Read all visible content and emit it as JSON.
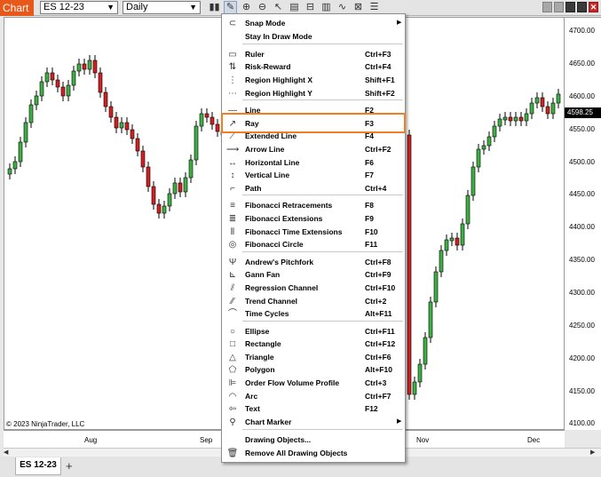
{
  "toolbar": {
    "chart_tab": "Chart",
    "instrument": "ES 12-23",
    "interval": "Daily",
    "icons": [
      "bars-icon",
      "draw-tool-icon",
      "zoom-in-icon",
      "zoom-out-icon",
      "pointer-icon",
      "data-box-icon",
      "properties-icon",
      "instrument-icon",
      "indicator-icon",
      "strategy-icon",
      "list-icon"
    ]
  },
  "chart": {
    "copyright": "© 2023 NinjaTrader, LLC",
    "current_price": "4598.25",
    "y_ticks": [
      "4700.00",
      "4650.00",
      "4600.00",
      "4550.00",
      "4500.00",
      "4450.00",
      "4400.00",
      "4350.00",
      "4300.00",
      "4250.00",
      "4200.00",
      "4150.00",
      "4100.00"
    ],
    "x_ticks": [
      "Aug",
      "Sep",
      "Nov",
      "Dec"
    ],
    "colors": {
      "up": "#3cb043",
      "down": "#d42020",
      "wick": "#000000"
    }
  },
  "bottom": {
    "instrument_tab": "ES 12-23",
    "add_tab": "+"
  },
  "menu": {
    "items": [
      {
        "label": "Snap Mode",
        "shortcut": "",
        "icon": "magnet-icon",
        "submenu": true
      },
      {
        "label": "Stay In Draw Mode",
        "shortcut": "",
        "icon": "",
        "submenu": false
      },
      {
        "label": "Ruler",
        "shortcut": "Ctrl+F3",
        "icon": "ruler-icon",
        "submenu": false
      },
      {
        "label": "Risk-Reward",
        "shortcut": "Ctrl+F4",
        "icon": "risk-reward-icon",
        "submenu": false
      },
      {
        "label": "Region Highlight X",
        "shortcut": "Shift+F1",
        "icon": "region-x-icon",
        "submenu": false
      },
      {
        "label": "Region Highlight Y",
        "shortcut": "Shift+F2",
        "icon": "region-y-icon",
        "submenu": false
      },
      {
        "label": "Line",
        "shortcut": "F2",
        "icon": "line-icon",
        "submenu": false
      },
      {
        "label": "Ray",
        "shortcut": "F3",
        "icon": "ray-icon",
        "submenu": false
      },
      {
        "label": "Extended Line",
        "shortcut": "F4",
        "icon": "extended-line-icon",
        "submenu": false
      },
      {
        "label": "Arrow Line",
        "shortcut": "Ctrl+F2",
        "icon": "arrow-line-icon",
        "submenu": false
      },
      {
        "label": "Horizontal Line",
        "shortcut": "F6",
        "icon": "horizontal-line-icon",
        "submenu": false
      },
      {
        "label": "Vertical Line",
        "shortcut": "F7",
        "icon": "vertical-line-icon",
        "submenu": false
      },
      {
        "label": "Path",
        "shortcut": "Ctrl+4",
        "icon": "path-icon",
        "submenu": false
      },
      {
        "label": "Fibonacci Retracements",
        "shortcut": "F8",
        "icon": "fib-retracement-icon",
        "submenu": false
      },
      {
        "label": "Fibonacci Extensions",
        "shortcut": "F9",
        "icon": "fib-extension-icon",
        "submenu": false
      },
      {
        "label": "Fibonacci Time Extensions",
        "shortcut": "F10",
        "icon": "fib-time-icon",
        "submenu": false
      },
      {
        "label": "Fibonacci Circle",
        "shortcut": "F11",
        "icon": "fib-circle-icon",
        "submenu": false
      },
      {
        "label": "Andrew's Pitchfork",
        "shortcut": "Ctrl+F8",
        "icon": "pitchfork-icon",
        "submenu": false
      },
      {
        "label": "Gann Fan",
        "shortcut": "Ctrl+F9",
        "icon": "gann-fan-icon",
        "submenu": false
      },
      {
        "label": "Regression Channel",
        "shortcut": "Ctrl+F10",
        "icon": "regression-icon",
        "submenu": false
      },
      {
        "label": "Trend Channel",
        "shortcut": "Ctrl+2",
        "icon": "trend-channel-icon",
        "submenu": false
      },
      {
        "label": "Time Cycles",
        "shortcut": "Alt+F11",
        "icon": "time-cycles-icon",
        "submenu": false
      },
      {
        "label": "Ellipse",
        "shortcut": "Ctrl+F11",
        "icon": "ellipse-icon",
        "submenu": false
      },
      {
        "label": "Rectangle",
        "shortcut": "Ctrl+F12",
        "icon": "rectangle-icon",
        "submenu": false
      },
      {
        "label": "Triangle",
        "shortcut": "Ctrl+F6",
        "icon": "triangle-icon",
        "submenu": false
      },
      {
        "label": "Polygon",
        "shortcut": "Alt+F10",
        "icon": "polygon-icon",
        "submenu": false
      },
      {
        "label": "Order Flow Volume Profile",
        "shortcut": "Ctrl+3",
        "icon": "volume-profile-icon",
        "submenu": false
      },
      {
        "label": "Arc",
        "shortcut": "Ctrl+F7",
        "icon": "arc-icon",
        "submenu": false
      },
      {
        "label": "Text",
        "shortcut": "F12",
        "icon": "text-icon",
        "submenu": false
      },
      {
        "label": "Chart Marker",
        "shortcut": "",
        "icon": "marker-icon",
        "submenu": true
      },
      {
        "label": "Drawing Objects...",
        "shortcut": "",
        "icon": "",
        "submenu": false
      },
      {
        "label": "Remove All Drawing Objects",
        "shortcut": "",
        "icon": "trash-icon",
        "submenu": false
      }
    ]
  }
}
